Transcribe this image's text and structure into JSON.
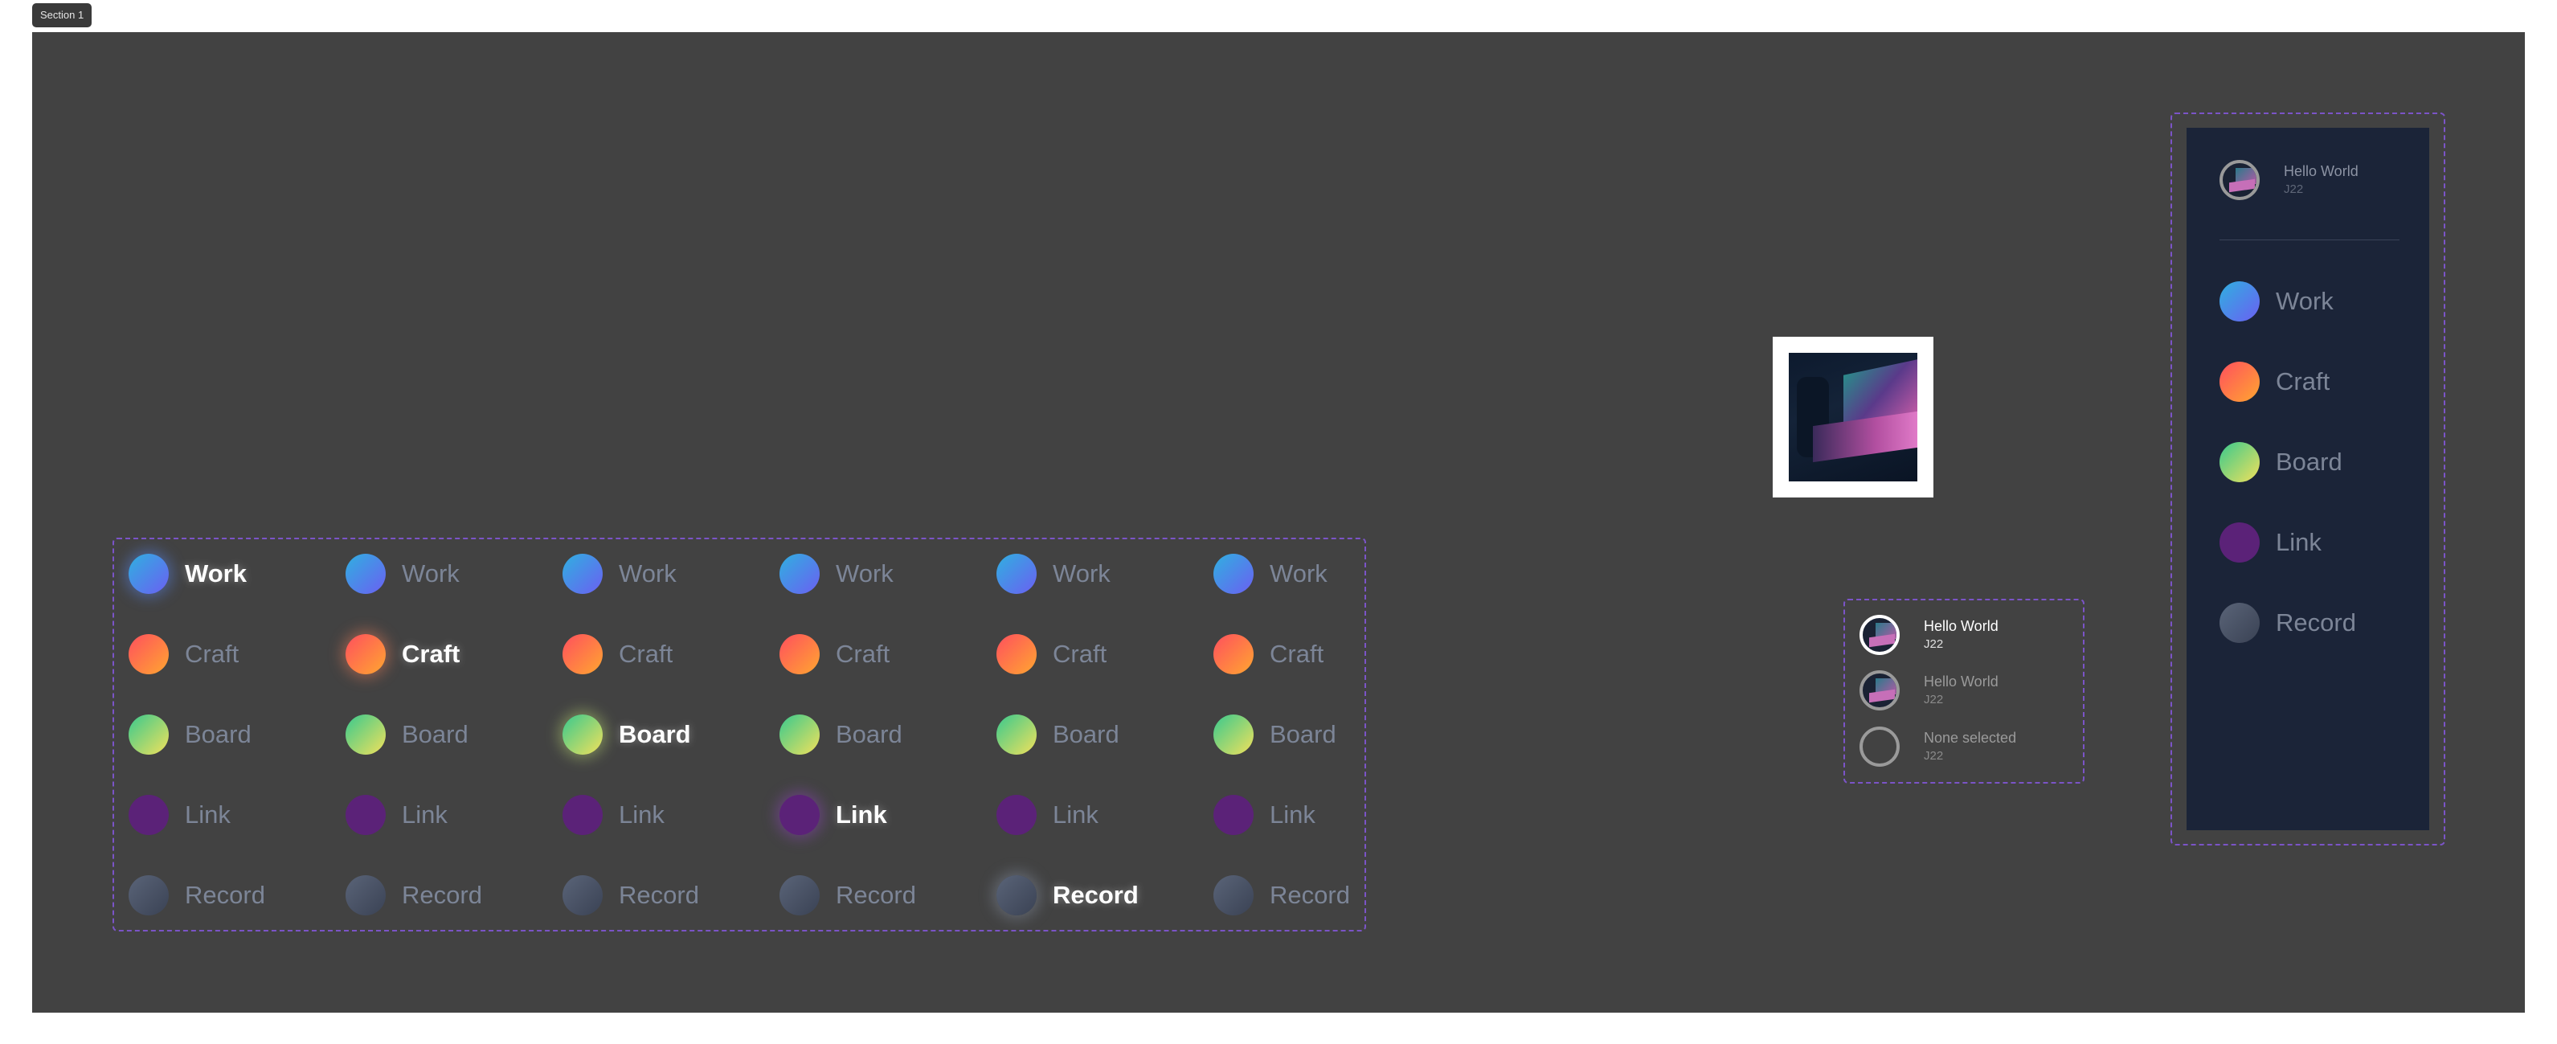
{
  "section": {
    "label": "Section 1"
  },
  "grid": {
    "items": [
      {
        "key": "work",
        "label": "Work"
      },
      {
        "key": "craft",
        "label": "Craft"
      },
      {
        "key": "board",
        "label": "Board"
      },
      {
        "key": "link",
        "label": "Link"
      },
      {
        "key": "record",
        "label": "Record"
      }
    ],
    "variant_count": 6
  },
  "switcher": {
    "accounts": [
      {
        "name": "Hello World",
        "sub": "J22",
        "selected": true
      },
      {
        "name": "Hello World",
        "sub": "J22",
        "selected": false
      },
      {
        "name": "None selected",
        "sub": "J22",
        "selected": false
      }
    ]
  },
  "sidebar": {
    "user": {
      "name": "Hello World",
      "sub": "J22"
    },
    "items": [
      {
        "key": "work",
        "label": "Work"
      },
      {
        "key": "craft",
        "label": "Craft"
      },
      {
        "key": "board",
        "label": "Board"
      },
      {
        "key": "link",
        "label": "Link"
      },
      {
        "key": "record",
        "label": "Record"
      }
    ]
  },
  "colors": {
    "canvas": "#424242",
    "frame_dash": "#7b54c7",
    "sidebar_bg": "#1b2438",
    "inactive_text": "#7c8597",
    "active_text": "#ffffff"
  }
}
